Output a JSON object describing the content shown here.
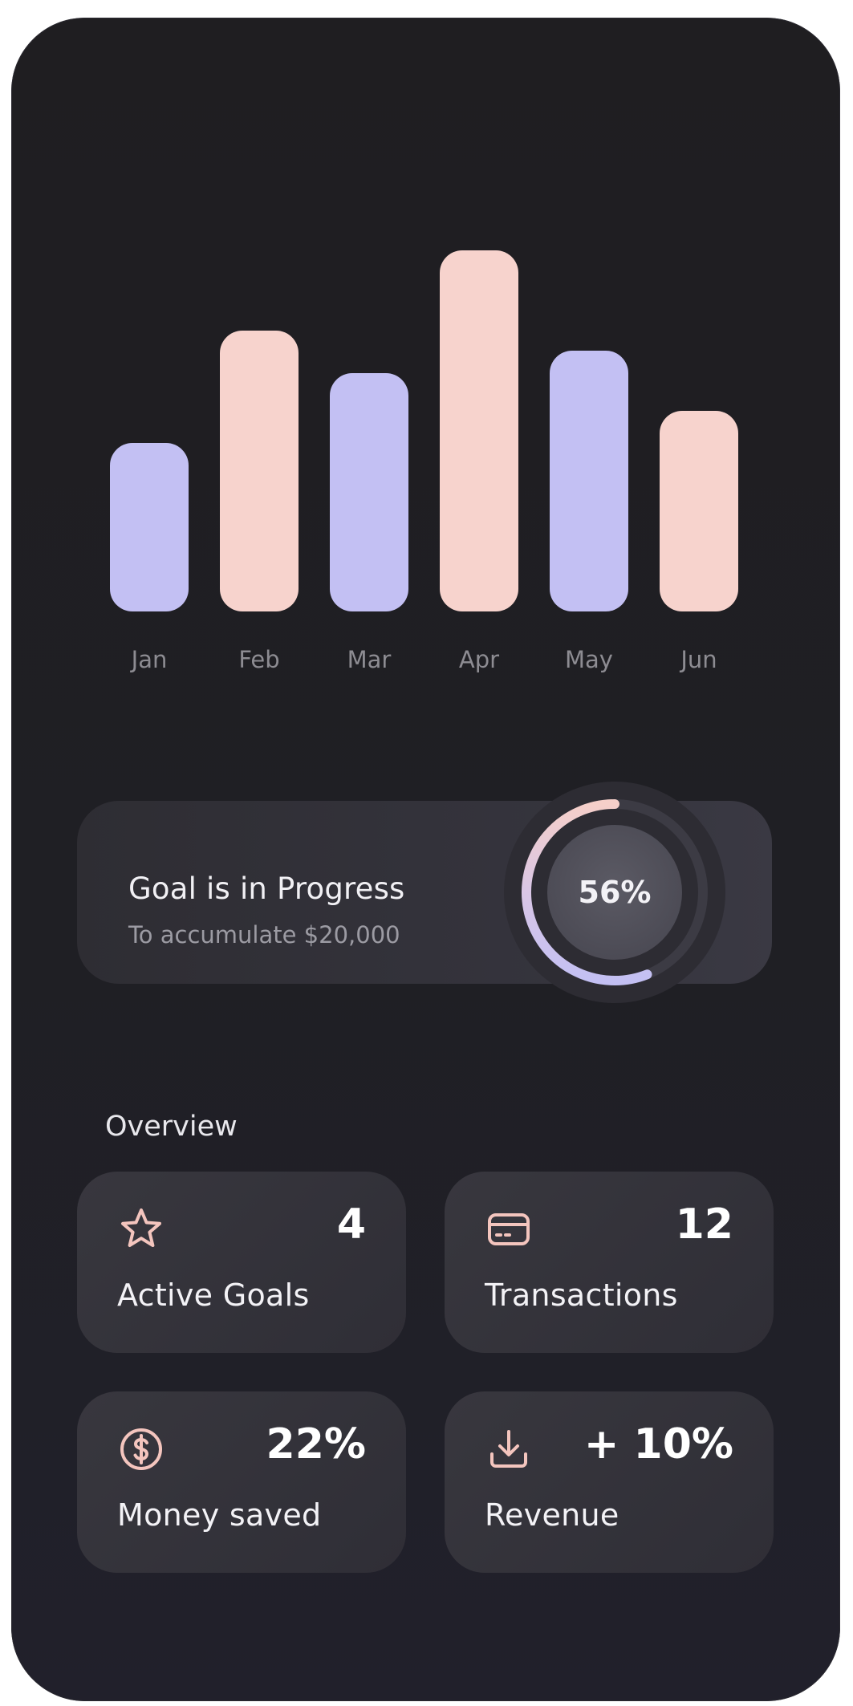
{
  "colors": {
    "lavender": "#c3c0f3",
    "peach": "#f7d3cd",
    "background": "#1f1e22",
    "card": "#35343c",
    "icon_accent": "#f4c5be"
  },
  "chart_data": {
    "type": "bar",
    "categories": [
      "Jan",
      "Feb",
      "Mar",
      "Apr",
      "May",
      "Jun"
    ],
    "values": [
      210,
      350,
      297,
      450,
      325,
      250
    ],
    "bar_colors": [
      "lavender",
      "peach",
      "lavender",
      "peach",
      "lavender",
      "peach"
    ],
    "title": "",
    "xlabel": "",
    "ylabel": "",
    "grid": false
  },
  "goal": {
    "title": "Goal is in Progress",
    "subtitle": "To accumulate $20,000",
    "progress": 0.56,
    "progress_label": "56%"
  },
  "overview": {
    "title": "Overview",
    "stats": [
      {
        "icon": "star-icon",
        "value": "4",
        "label": "Active Goals"
      },
      {
        "icon": "credit-card-icon",
        "value": "12",
        "label": "Transactions"
      },
      {
        "icon": "dollar-circle-icon",
        "value": "22%",
        "label": "Money saved"
      },
      {
        "icon": "download-icon",
        "value": "+ 10%",
        "label": "Revenue"
      }
    ]
  }
}
